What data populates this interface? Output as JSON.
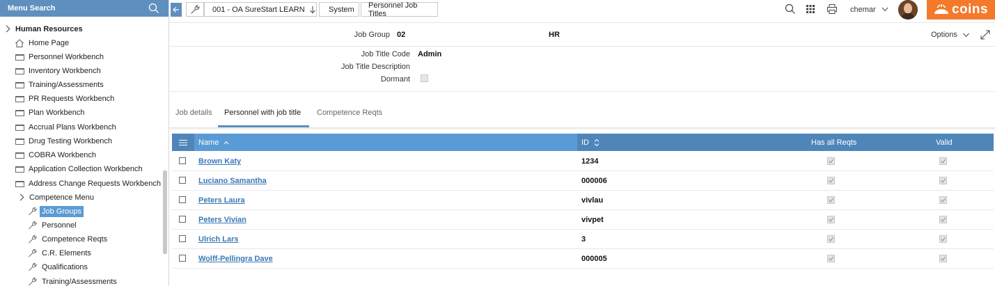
{
  "sidebar": {
    "search_label": "Menu Search",
    "root_label": "Human Resources",
    "items": [
      {
        "label": "Home Page",
        "icon": "home-icon"
      },
      {
        "label": "Personnel Workbench",
        "icon": "folder-icon"
      },
      {
        "label": "Inventory Workbench",
        "icon": "folder-icon"
      },
      {
        "label": "Training/Assessments",
        "icon": "folder-icon"
      },
      {
        "label": "PR Requests Workbench",
        "icon": "folder-icon"
      },
      {
        "label": "Plan Workbench",
        "icon": "folder-icon"
      },
      {
        "label": "Accrual Plans Workbench",
        "icon": "folder-icon"
      },
      {
        "label": "Drug Testing Workbench",
        "icon": "folder-icon"
      },
      {
        "label": "COBRA Workbench",
        "icon": "folder-icon"
      },
      {
        "label": "Application Collection Workbench",
        "icon": "folder-icon"
      },
      {
        "label": "Address Change Requests Workbench",
        "icon": "folder-icon"
      }
    ],
    "submenu_label": "Competence Menu",
    "subitems": [
      {
        "label": "Job Groups",
        "icon": "wrench-icon",
        "selected": true
      },
      {
        "label": "Personnel",
        "icon": "wrench-icon"
      },
      {
        "label": "Competence Reqts",
        "icon": "wrench-icon"
      },
      {
        "label": "C.R. Elements",
        "icon": "wrench-icon"
      },
      {
        "label": "Qualifications",
        "icon": "wrench-icon"
      },
      {
        "label": "Training/Assessments",
        "icon": "wrench-icon"
      }
    ]
  },
  "breadcrumb": {
    "company": "001 - OA SureStart LEARN",
    "system": "System",
    "page": "Personnel Job Titles"
  },
  "user": {
    "name": "chemar"
  },
  "brand": {
    "logo_text": "coins",
    "color": "#f4792b"
  },
  "header": {
    "job_group_label": "Job Group",
    "job_group_value": "02",
    "job_group_desc": "HR",
    "options_label": "Options",
    "job_title_code_label": "Job Title Code",
    "job_title_code_value": "Admin",
    "job_title_desc_label": "Job Title Description",
    "dormant_label": "Dormant"
  },
  "tabs": [
    {
      "label": "Job details"
    },
    {
      "label": "Personnel with job title",
      "active": true
    },
    {
      "label": "Competence Reqts"
    }
  ],
  "grid": {
    "columns": {
      "name": "Name",
      "id": "ID",
      "has_all_reqts": "Has all Reqts",
      "valid": "Valid"
    },
    "rows": [
      {
        "name": "Brown Katy",
        "id": "1234",
        "has_all_reqts": true,
        "valid": true
      },
      {
        "name": "Luciano Samantha",
        "id": "000006",
        "has_all_reqts": true,
        "valid": true
      },
      {
        "name": "Peters Laura",
        "id": "vivlau",
        "has_all_reqts": true,
        "valid": true
      },
      {
        "name": "Peters Vivian",
        "id": "vivpet",
        "has_all_reqts": true,
        "valid": true
      },
      {
        "name": "Ulrich Lars",
        "id": "3",
        "has_all_reqts": true,
        "valid": true
      },
      {
        "name": "Wolff-Pellingra Dave",
        "id": "000005",
        "has_all_reqts": true,
        "valid": true
      }
    ]
  },
  "colors": {
    "accent": "#5b9bd5",
    "header_dark": "#4f86b9",
    "link": "#3a78b5"
  }
}
